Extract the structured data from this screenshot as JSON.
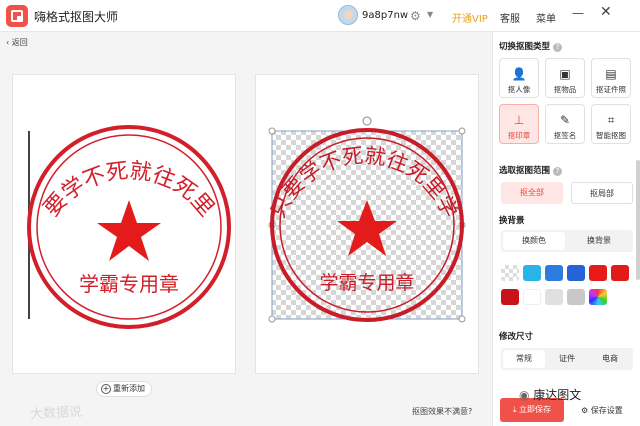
{
  "app": {
    "title": "嗨格式抠图大师",
    "username": "9a8p7nw",
    "vip": "开通VIP",
    "service": "客服",
    "menu": "菜单"
  },
  "toolbar": {
    "back": "返回",
    "readd": "重新添加",
    "feedback": "抠图效果不满意?"
  },
  "stamp": {
    "text": "只要学不死就往死里学",
    "subtitle": "学霸专用章"
  },
  "colors": {
    "accent": "#f0524a",
    "stamp": "#d21f2a",
    "vip": "#e8a11c"
  },
  "sidebar": {
    "type_title": "切换抠图类型",
    "types": [
      {
        "label": "抠人像",
        "icon": "person-icon"
      },
      {
        "label": "抠物品",
        "icon": "bag-icon"
      },
      {
        "label": "抠证件照",
        "icon": "idcard-icon"
      },
      {
        "label": "抠印章",
        "icon": "stamp-icon"
      },
      {
        "label": "抠签名",
        "icon": "pen-icon"
      },
      {
        "label": "智能抠图",
        "icon": "ai-icon"
      }
    ],
    "range_title": "选取抠图范围",
    "range_all": "抠全部",
    "range_part": "抠局部",
    "bg_title": "换背景",
    "bg_color": "换颜色",
    "bg_image": "换背景",
    "swatches": [
      "transparent",
      "#29b3e8",
      "#2e7be0",
      "#2563d8",
      "#e8191b",
      "#e31a1a",
      "#c81418",
      "#ffffff",
      "#e0e0e0",
      "#c8c8c8",
      "gradient"
    ],
    "size_title": "修改尺寸",
    "size_tabs": [
      "常规",
      "证件",
      "电商"
    ],
    "save": "立即保存",
    "save_settings": "保存设置"
  },
  "watermarks": {
    "left": "大数据说",
    "right": "康达图文"
  }
}
